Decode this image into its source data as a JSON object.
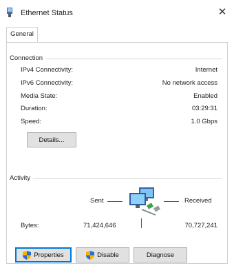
{
  "window": {
    "title": "Ethernet Status",
    "close_glyph": "✕"
  },
  "tabs": [
    {
      "label": "General"
    }
  ],
  "connection": {
    "group_label": "Connection",
    "rows": [
      {
        "label": "IPv4 Connectivity:",
        "value": "Internet"
      },
      {
        "label": "IPv6 Connectivity:",
        "value": "No network access"
      },
      {
        "label": "Media State:",
        "value": "Enabled"
      },
      {
        "label": "Duration:",
        "value": "03:29:31"
      },
      {
        "label": "Speed:",
        "value": "1.0 Gbps"
      }
    ],
    "details_button": "Details..."
  },
  "activity": {
    "group_label": "Activity",
    "sent_label": "Sent",
    "received_label": "Received",
    "bytes_label": "Bytes:",
    "bytes_sent": "71,424,646",
    "bytes_received": "70,727,241"
  },
  "buttons": {
    "properties": "Properties",
    "disable": "Disable",
    "diagnose": "Diagnose"
  },
  "icons": {
    "window": "network-adapter-icon",
    "network": "network-computers-icon",
    "shield": "uac-shield-icon"
  },
  "colors": {
    "focus_border": "#0078d7",
    "button_face": "#e1e1e1"
  }
}
